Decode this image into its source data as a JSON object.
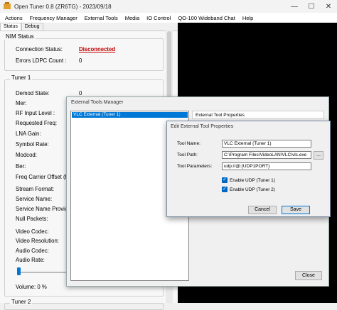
{
  "window": {
    "title": "Open Tuner 0.8 (ZR6TG) - 2023/09/18",
    "min_glyph": "—",
    "max_glyph": "☐",
    "close_glyph": "✕"
  },
  "menu": [
    "Actions",
    "Frequency Manager",
    "External Tools",
    "Media",
    "IO Control",
    "QO-100 Wideband Chat",
    "Help"
  ],
  "tabs": [
    "Status",
    "Debug"
  ],
  "nim": {
    "title": "NIM Status",
    "connection_label": "Connection Status:",
    "connection_value": "Disconnected",
    "connection_color": "#c00000",
    "errors_label": "Errors LDPC Count :",
    "errors_value": "0"
  },
  "tuner1": {
    "title": "Tuner 1",
    "demod_label": "Demod State:",
    "demod_value": "0",
    "labels": [
      "Mer:",
      "RF Input Level :",
      "Requested Freq:",
      "LNA Gain:",
      "Symbol Rate:",
      "Modcod:",
      "Ber:",
      "Freq Carrier Offset (H",
      "Stream Format:",
      "Service Name:",
      "Service Name Provic",
      "Null Packets:",
      "Video Codec:",
      "Video Resolution:",
      "Audio Codec:",
      "Audio Rate:"
    ],
    "volume_label": "Volume: 0 %",
    "volume_level": 0
  },
  "tuner2": {
    "title": "Tuner 2"
  },
  "etm": {
    "title": "External Tools Manager",
    "list_items": [
      "VLC External (Tuner 1)"
    ],
    "properties_tab": "External Tool Properties",
    "close_label": "Close"
  },
  "edit": {
    "title": "Edit External Tool Properties",
    "name_label": "Tool Name:",
    "name_value": "VLC External (Tuner 1)",
    "path_label": "Tool Path:",
    "path_value": "C:\\Program Files\\VideoLAN\\VLC\\vlc.exe",
    "browse_label": "...",
    "params_label": "Tool Parameters:",
    "params_value": "udp://@:{UDP1PORT}",
    "udp1_label": "Enable UDP (Tuner 1)",
    "udp1_checked": true,
    "udp2_label": "Enable UDP (Tuner 2)",
    "udp2_checked": true,
    "cancel_label": "Cancel",
    "save_label": "Save",
    "check_glyph": "✓"
  }
}
